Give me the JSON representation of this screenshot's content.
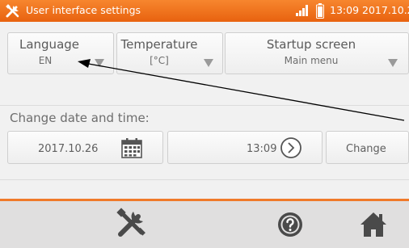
{
  "statusbar": {
    "title": "User interface settings",
    "time": "13:09",
    "date": "2017.10.26"
  },
  "settings": {
    "language": {
      "label": "Language",
      "value": "EN"
    },
    "temperature": {
      "label": "Temperature",
      "value": "[°C]"
    },
    "startup": {
      "label": "Startup screen",
      "value": "Main menu"
    }
  },
  "datetime": {
    "section_label": "Change date and time:",
    "date_value": "2017.10.26",
    "time_value": "13:09",
    "change_label": "Change"
  },
  "toolbar": {
    "icons": [
      "settings-tools-icon",
      "help-icon",
      "home-icon"
    ]
  },
  "colors": {
    "accent": "#f07a2a",
    "background": "#f1f1f1"
  }
}
